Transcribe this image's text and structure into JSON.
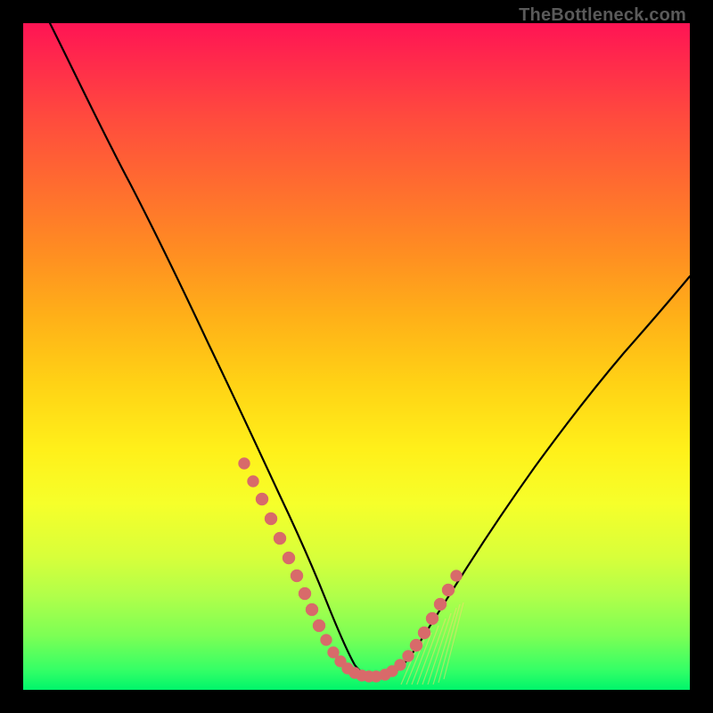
{
  "watermark": "TheBottleneck.com",
  "colors": {
    "frame": "#000000",
    "curve": "#000000",
    "dots": "#d86a6a",
    "hatch": "#f7da6e"
  },
  "chart_data": {
    "type": "line",
    "title": "",
    "xlabel": "",
    "ylabel": "",
    "xlim": [
      0,
      100
    ],
    "ylim": [
      0,
      100
    ],
    "note": "axes are unlabeled; values below are read off the plot in percent of the plot area. y is the curve height from the bottom (0 = bottom edge, 100 = top). Curve is a V-shape: steep descending arm from top-left toward the flat trough around x≈40–55, then rising to the right.",
    "series": [
      {
        "name": "curve",
        "x": [
          4,
          8,
          12,
          16,
          20,
          24,
          28,
          32,
          36,
          38,
          40,
          42,
          44,
          46,
          48,
          50,
          52,
          54,
          56,
          58,
          60,
          64,
          68,
          72,
          76,
          80,
          84,
          88,
          92,
          96,
          100
        ],
        "y": [
          100,
          92,
          84,
          76,
          67,
          58,
          49,
          40,
          30,
          25,
          20,
          15,
          10,
          6,
          3.5,
          2.5,
          2.5,
          3,
          5,
          8,
          11,
          17,
          23,
          29,
          35,
          41,
          47,
          52,
          57,
          61,
          64
        ]
      }
    ],
    "marker_points_left_arm": {
      "name": "dots-left",
      "x": [
        32,
        33.5,
        35,
        36.5,
        38,
        39.5,
        40.5,
        42,
        43,
        44.2,
        45.4,
        46.6,
        48,
        49.3
      ],
      "y": [
        36,
        31,
        26.5,
        22,
        18,
        14.5,
        12,
        9.5,
        7.5,
        6,
        5,
        4,
        3,
        2.5
      ]
    },
    "marker_points_right_arm": {
      "name": "dots-right",
      "x": [
        53.5,
        55,
        56.3,
        57.6,
        58.8,
        60,
        61.2,
        62.3,
        63.4,
        64.5
      ],
      "y": [
        3.5,
        5,
        6.8,
        8.8,
        11,
        13.3,
        15.5,
        17.6,
        19.6,
        21.5
      ]
    },
    "hatch_region": {
      "name": "yellow-hatch-right-of-minimum",
      "x_range": [
        56,
        66
      ],
      "y_range": [
        2,
        22
      ]
    }
  }
}
